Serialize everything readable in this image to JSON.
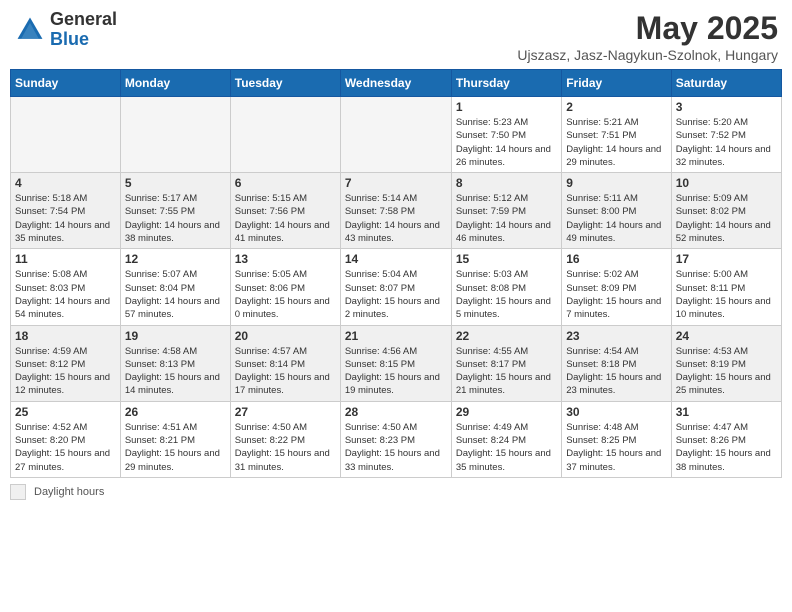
{
  "header": {
    "logo_general": "General",
    "logo_blue": "Blue",
    "month_year": "May 2025",
    "location": "Ujszasz, Jasz-Nagykun-Szolnok, Hungary"
  },
  "days_of_week": [
    "Sunday",
    "Monday",
    "Tuesday",
    "Wednesday",
    "Thursday",
    "Friday",
    "Saturday"
  ],
  "weeks": [
    [
      {
        "day": "",
        "info": ""
      },
      {
        "day": "",
        "info": ""
      },
      {
        "day": "",
        "info": ""
      },
      {
        "day": "",
        "info": ""
      },
      {
        "day": "1",
        "info": "Sunrise: 5:23 AM\nSunset: 7:50 PM\nDaylight: 14 hours\nand 26 minutes."
      },
      {
        "day": "2",
        "info": "Sunrise: 5:21 AM\nSunset: 7:51 PM\nDaylight: 14 hours\nand 29 minutes."
      },
      {
        "day": "3",
        "info": "Sunrise: 5:20 AM\nSunset: 7:52 PM\nDaylight: 14 hours\nand 32 minutes."
      }
    ],
    [
      {
        "day": "4",
        "info": "Sunrise: 5:18 AM\nSunset: 7:54 PM\nDaylight: 14 hours\nand 35 minutes."
      },
      {
        "day": "5",
        "info": "Sunrise: 5:17 AM\nSunset: 7:55 PM\nDaylight: 14 hours\nand 38 minutes."
      },
      {
        "day": "6",
        "info": "Sunrise: 5:15 AM\nSunset: 7:56 PM\nDaylight: 14 hours\nand 41 minutes."
      },
      {
        "day": "7",
        "info": "Sunrise: 5:14 AM\nSunset: 7:58 PM\nDaylight: 14 hours\nand 43 minutes."
      },
      {
        "day": "8",
        "info": "Sunrise: 5:12 AM\nSunset: 7:59 PM\nDaylight: 14 hours\nand 46 minutes."
      },
      {
        "day": "9",
        "info": "Sunrise: 5:11 AM\nSunset: 8:00 PM\nDaylight: 14 hours\nand 49 minutes."
      },
      {
        "day": "10",
        "info": "Sunrise: 5:09 AM\nSunset: 8:02 PM\nDaylight: 14 hours\nand 52 minutes."
      }
    ],
    [
      {
        "day": "11",
        "info": "Sunrise: 5:08 AM\nSunset: 8:03 PM\nDaylight: 14 hours\nand 54 minutes."
      },
      {
        "day": "12",
        "info": "Sunrise: 5:07 AM\nSunset: 8:04 PM\nDaylight: 14 hours\nand 57 minutes."
      },
      {
        "day": "13",
        "info": "Sunrise: 5:05 AM\nSunset: 8:06 PM\nDaylight: 15 hours\nand 0 minutes."
      },
      {
        "day": "14",
        "info": "Sunrise: 5:04 AM\nSunset: 8:07 PM\nDaylight: 15 hours\nand 2 minutes."
      },
      {
        "day": "15",
        "info": "Sunrise: 5:03 AM\nSunset: 8:08 PM\nDaylight: 15 hours\nand 5 minutes."
      },
      {
        "day": "16",
        "info": "Sunrise: 5:02 AM\nSunset: 8:09 PM\nDaylight: 15 hours\nand 7 minutes."
      },
      {
        "day": "17",
        "info": "Sunrise: 5:00 AM\nSunset: 8:11 PM\nDaylight: 15 hours\nand 10 minutes."
      }
    ],
    [
      {
        "day": "18",
        "info": "Sunrise: 4:59 AM\nSunset: 8:12 PM\nDaylight: 15 hours\nand 12 minutes."
      },
      {
        "day": "19",
        "info": "Sunrise: 4:58 AM\nSunset: 8:13 PM\nDaylight: 15 hours\nand 14 minutes."
      },
      {
        "day": "20",
        "info": "Sunrise: 4:57 AM\nSunset: 8:14 PM\nDaylight: 15 hours\nand 17 minutes."
      },
      {
        "day": "21",
        "info": "Sunrise: 4:56 AM\nSunset: 8:15 PM\nDaylight: 15 hours\nand 19 minutes."
      },
      {
        "day": "22",
        "info": "Sunrise: 4:55 AM\nSunset: 8:17 PM\nDaylight: 15 hours\nand 21 minutes."
      },
      {
        "day": "23",
        "info": "Sunrise: 4:54 AM\nSunset: 8:18 PM\nDaylight: 15 hours\nand 23 minutes."
      },
      {
        "day": "24",
        "info": "Sunrise: 4:53 AM\nSunset: 8:19 PM\nDaylight: 15 hours\nand 25 minutes."
      }
    ],
    [
      {
        "day": "25",
        "info": "Sunrise: 4:52 AM\nSunset: 8:20 PM\nDaylight: 15 hours\nand 27 minutes."
      },
      {
        "day": "26",
        "info": "Sunrise: 4:51 AM\nSunset: 8:21 PM\nDaylight: 15 hours\nand 29 minutes."
      },
      {
        "day": "27",
        "info": "Sunrise: 4:50 AM\nSunset: 8:22 PM\nDaylight: 15 hours\nand 31 minutes."
      },
      {
        "day": "28",
        "info": "Sunrise: 4:50 AM\nSunset: 8:23 PM\nDaylight: 15 hours\nand 33 minutes."
      },
      {
        "day": "29",
        "info": "Sunrise: 4:49 AM\nSunset: 8:24 PM\nDaylight: 15 hours\nand 35 minutes."
      },
      {
        "day": "30",
        "info": "Sunrise: 4:48 AM\nSunset: 8:25 PM\nDaylight: 15 hours\nand 37 minutes."
      },
      {
        "day": "31",
        "info": "Sunrise: 4:47 AM\nSunset: 8:26 PM\nDaylight: 15 hours\nand 38 minutes."
      }
    ]
  ],
  "footer": {
    "legend_label": "Daylight hours"
  }
}
